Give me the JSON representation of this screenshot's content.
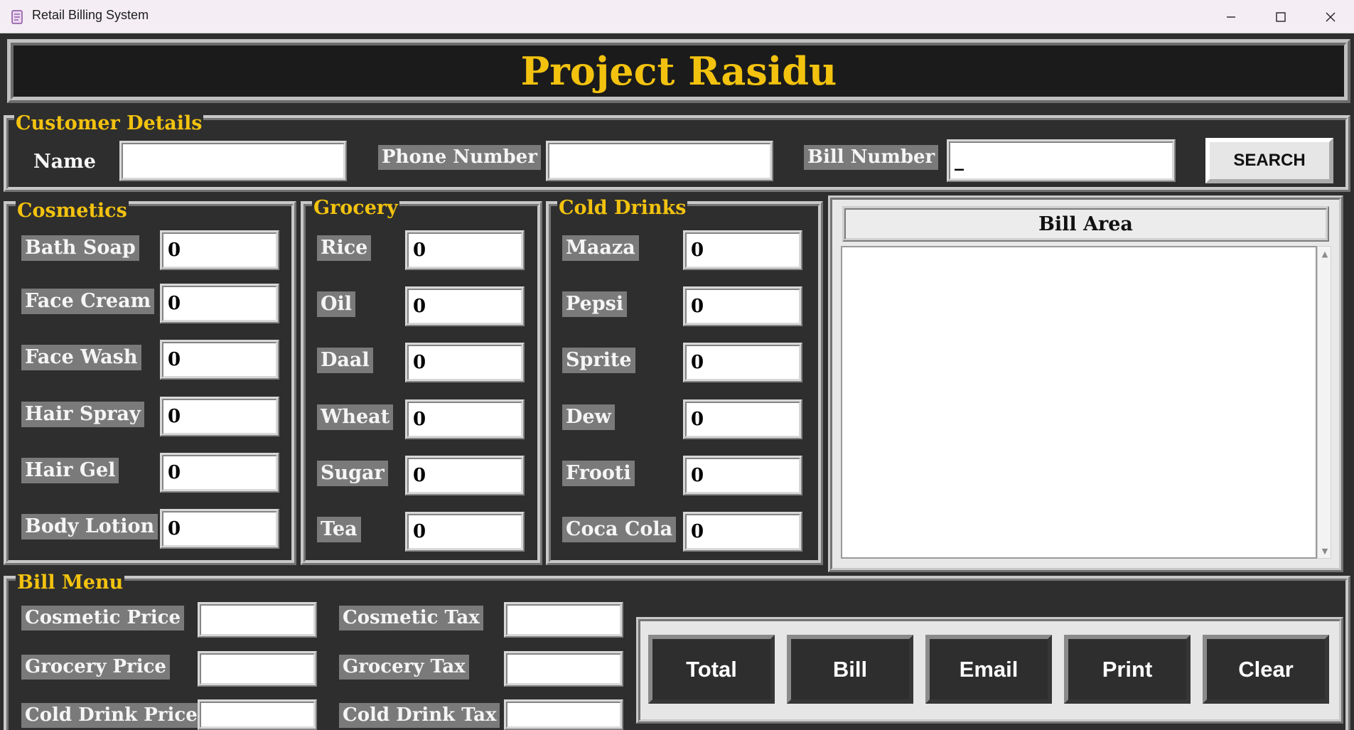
{
  "window": {
    "title": "Retail Billing System",
    "minimize_icon": "minimize-icon",
    "maximize_icon": "maximize-icon",
    "close_icon": "close-icon"
  },
  "banner": {
    "title": "Project Rasidu"
  },
  "customer": {
    "legend": "Customer Details",
    "name_label": "Name",
    "name_value": "",
    "phone_label": "Phone Number",
    "phone_value": "",
    "bill_label": "Bill Number",
    "bill_value": "_",
    "search_label": "SEARCH"
  },
  "cosmetics": {
    "legend": "Cosmetics",
    "items": [
      {
        "label": "Bath Soap",
        "value": "0"
      },
      {
        "label": "Face Cream",
        "value": "0"
      },
      {
        "label": "Face Wash",
        "value": "0"
      },
      {
        "label": "Hair Spray",
        "value": "0"
      },
      {
        "label": "Hair Gel",
        "value": "0"
      },
      {
        "label": "Body Lotion",
        "value": "0"
      }
    ]
  },
  "grocery": {
    "legend": "Grocery",
    "items": [
      {
        "label": "Rice",
        "value": "0"
      },
      {
        "label": "Oil",
        "value": "0"
      },
      {
        "label": "Daal",
        "value": "0"
      },
      {
        "label": "Wheat",
        "value": "0"
      },
      {
        "label": "Sugar",
        "value": "0"
      },
      {
        "label": "Tea",
        "value": "0"
      }
    ]
  },
  "drinks": {
    "legend": "Cold Drinks",
    "items": [
      {
        "label": "Maaza",
        "value": "0"
      },
      {
        "label": "Pepsi",
        "value": "0"
      },
      {
        "label": "Sprite",
        "value": "0"
      },
      {
        "label": "Dew",
        "value": "0"
      },
      {
        "label": "Frooti",
        "value": "0"
      },
      {
        "label": "Coca Cola",
        "value": "0"
      }
    ]
  },
  "bill_area": {
    "heading": "Bill Area",
    "content": ""
  },
  "bill_menu": {
    "legend": "Bill Menu",
    "cosmetic_price_label": "Cosmetic Price",
    "cosmetic_price_value": "",
    "grocery_price_label": "Grocery Price",
    "grocery_price_value": "",
    "cold_drink_price_label": "Cold Drink Price",
    "cold_drink_price_value": "",
    "cosmetic_tax_label": "Cosmetic Tax",
    "cosmetic_tax_value": "",
    "grocery_tax_label": "Grocery Tax",
    "grocery_tax_value": "",
    "cold_drink_tax_label": "Cold Drink Tax",
    "cold_drink_tax_value": ""
  },
  "actions": {
    "total": "Total",
    "bill": "Bill",
    "email": "Email",
    "print": "Print",
    "clear": "Clear"
  },
  "colors": {
    "background": "#2e2e2e",
    "accent": "#f2c20f",
    "label_bg": "#7a7a7a"
  }
}
